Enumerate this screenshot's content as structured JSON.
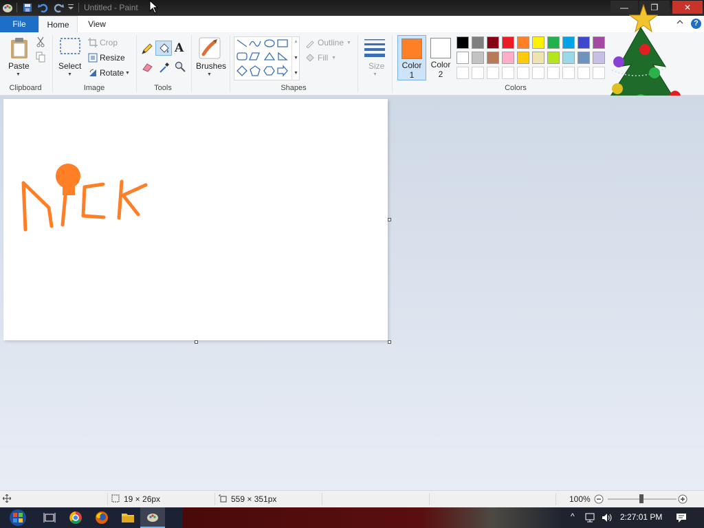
{
  "window": {
    "title": "Untitled - Paint",
    "minimize": "—",
    "maximize": "❐",
    "close": "✕"
  },
  "tabs": {
    "file": "File",
    "home": "Home",
    "view": "View",
    "help": "?"
  },
  "ribbon": {
    "clipboard": {
      "paste": "Paste",
      "label": "Clipboard"
    },
    "image": {
      "select": "Select",
      "crop": "Crop",
      "resize": "Resize",
      "rotate": "Rotate",
      "label": "Image"
    },
    "tools": {
      "label": "Tools"
    },
    "brushes": {
      "label": "Brushes"
    },
    "shapes": {
      "outline": "Outline",
      "fill": "Fill",
      "label": "Shapes"
    },
    "size": {
      "label": "Size"
    },
    "colors": {
      "color1_label": "Color 1",
      "color1_number": "1",
      "color1_word": "Color",
      "color2_word": "Color",
      "color2_number": "2",
      "label": "Colors",
      "color1": "#ff7f27",
      "color2": "#ffffff",
      "palette_row1": [
        "#000000",
        "#7f7f7f",
        "#880015",
        "#ed1c24",
        "#ff7f27",
        "#fff200",
        "#22b14c",
        "#00a2e8",
        "#3f48cc",
        "#a349a4"
      ],
      "palette_row2": [
        "#ffffff",
        "#c3c3c3",
        "#b97a57",
        "#ffaec9",
        "#ffc90e",
        "#efe4b0",
        "#b5e61d",
        "#99d9ea",
        "#7092be",
        "#c8bfe7"
      ]
    }
  },
  "canvas": {
    "drawing_text": "Nick",
    "stroke_color": "#ff7f27"
  },
  "status": {
    "selection_size": "19 × 26px",
    "canvas_size": "559 × 351px",
    "zoom": "100%"
  },
  "taskbar": {
    "clock": "2:27:01 PM",
    "tray_chevron": "^"
  }
}
